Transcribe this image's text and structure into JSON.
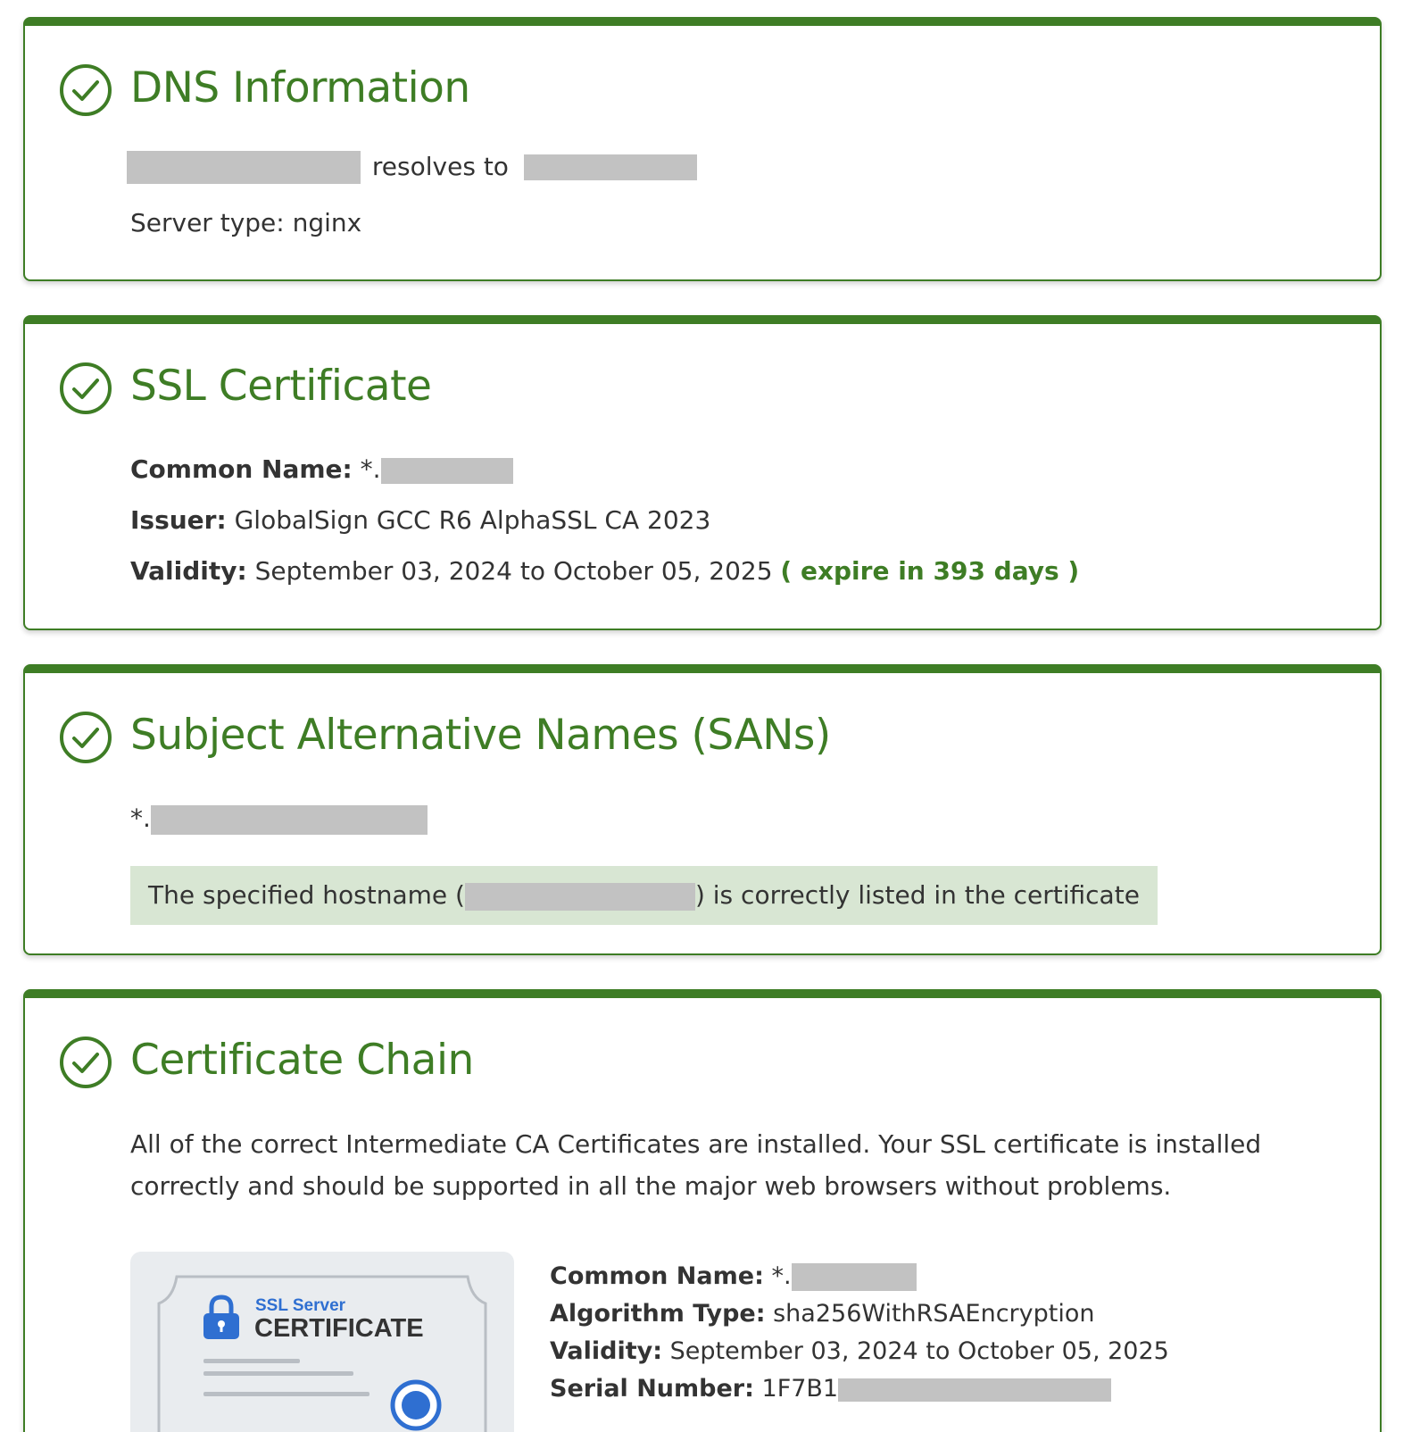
{
  "dns": {
    "title": "DNS Information",
    "resolves_text": "resolves to",
    "server_type": "Server type: nginx"
  },
  "ssl": {
    "title": "SSL Certificate",
    "common_name_label": "Common Name:",
    "common_name_value": "*.",
    "issuer_label": "Issuer:",
    "issuer_value": "GlobalSign GCC R6 AlphaSSL CA 2023",
    "validity_label": "Validity:",
    "validity_value": "September 03, 2024 to October 05, 2025",
    "expire_text": "( expire in 393 days )"
  },
  "sans": {
    "title": "Subject Alternative Names (SANs)",
    "entry_prefix": "*.",
    "notice_before": "The specified hostname (",
    "notice_after": ") is correctly listed in the certificate"
  },
  "chain": {
    "title": "Certificate Chain",
    "description": "All of the correct Intermediate CA Certificates are installed. Your SSL certificate is installed correctly and should be supported in all the major web browsers without problems.",
    "cert_image": {
      "small_label": "SSL Server",
      "big_label": "CERTIFICATE"
    },
    "common_name_label": "Common Name:",
    "common_name_value": "*.",
    "algorithm_label": "Algorithm Type:",
    "algorithm_value": "sha256WithRSAEncryption",
    "validity_label": "Validity:",
    "validity_value": "September 03, 2024 to October 05, 2025",
    "serial_label": "Serial Number:",
    "serial_value": "1F7B1"
  },
  "colors": {
    "accent_green": "#3e7d25",
    "notice_bg": "#d8e6d3",
    "redaction_gray": "#c2c2c2",
    "cert_blue": "#2f6fd1"
  }
}
